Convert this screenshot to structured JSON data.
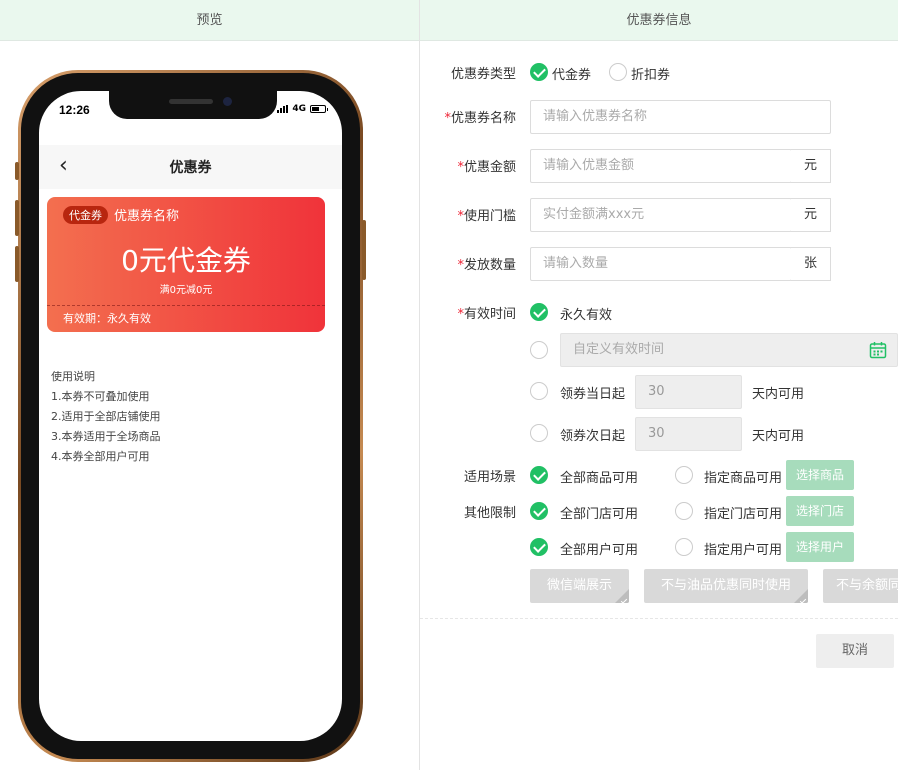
{
  "headers": {
    "preview": "预览",
    "info": "优惠券信息"
  },
  "phone": {
    "time": "12:26",
    "network": "4G",
    "nav_title": "优惠券",
    "coupon": {
      "badge": "代金券",
      "name": "优惠券名称",
      "amount": "0元代金券",
      "rule": "满0元减0元",
      "validity": "有效期：永久有效"
    },
    "usage": [
      "使用说明",
      "1.本券不可叠加使用",
      "2.适用于全部店铺使用",
      "3.本券适用于全场商品",
      "4.本券全部用户可用"
    ]
  },
  "form": {
    "type": {
      "label": "优惠券类型",
      "opt1": "代金券",
      "opt2": "折扣券"
    },
    "name": {
      "label": "优惠券名称",
      "placeholder": "请输入优惠券名称"
    },
    "amount": {
      "label": "优惠金额",
      "placeholder": "请输入优惠金额",
      "suffix": "元"
    },
    "threshold": {
      "label": "使用门槛",
      "placeholder": "实付金额满xxx元",
      "suffix": "元"
    },
    "quantity": {
      "label": "发放数量",
      "placeholder": "请输入数量",
      "suffix": "张"
    },
    "validity": {
      "label": "有效时间",
      "forever": "永久有效",
      "custom_placeholder": "自定义有效时间",
      "same_day": "领券当日起",
      "same_day_value": "30",
      "next_day": "领券次日起",
      "next_day_value": "30",
      "days_suffix": "天内可用"
    },
    "scene": {
      "label": "适用场景",
      "all": "全部商品可用",
      "specific": "指定商品可用",
      "button": "选择商品"
    },
    "limits": {
      "label": "其他限制",
      "store_all": "全部门店可用",
      "store_specific": "指定门店可用",
      "store_button": "选择门店",
      "user_all": "全部用户可用",
      "user_specific": "指定用户可用",
      "user_button": "选择用户"
    },
    "chips": [
      "微信端展示",
      "不与油品优惠同时使用",
      "不与余额同"
    ],
    "required_mark": "*",
    "cancel": "取消"
  },
  "colors": {
    "accent": "#21c065",
    "coupon_start": "#f36f4f",
    "coupon_end": "#f0333a",
    "header_bg": "#eaf8ee"
  }
}
